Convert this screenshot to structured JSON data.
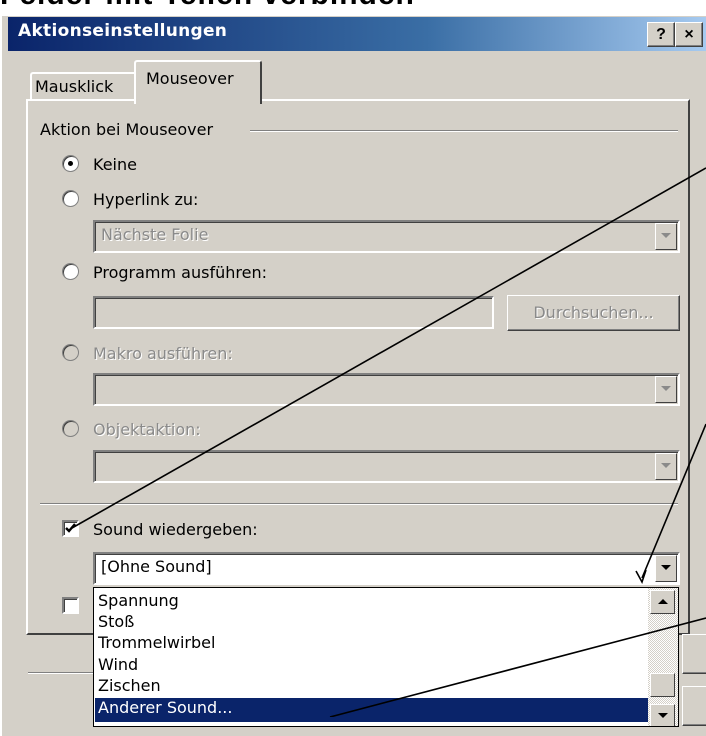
{
  "page": {
    "heading": "Felder mit Teilen verbinden"
  },
  "dialog": {
    "title": "Aktionseinstellungen",
    "help_button": "?",
    "close_button": "×",
    "tabs": [
      {
        "label": "Mausklick",
        "active": false
      },
      {
        "label": "Mouseover",
        "active": true
      }
    ],
    "group_label": "Aktion bei Mouseover",
    "options": {
      "keine": {
        "label": "Keine",
        "selected": true
      },
      "hyperlink": {
        "label": "Hyperlink zu:",
        "value": "Nächste Folie"
      },
      "programm": {
        "label": "Programm ausführen:",
        "value": "",
        "browse_button": "Durchsuchen..."
      },
      "makro": {
        "label": "Makro ausführen:",
        "enabled": false
      },
      "objekt": {
        "label": "Objektaktion:",
        "enabled": false
      }
    },
    "sound": {
      "label": "Sound wiedergeben:",
      "checked": true,
      "selected": "[Ohne Sound]",
      "list": [
        "Spannung",
        "Stoß",
        "Trommelwirbel",
        "Wind",
        "Zischen",
        "Anderer Sound..."
      ],
      "highlighted": "Anderer Sound..."
    },
    "second_checkbox_checked": false
  },
  "colors": {
    "titlebar_start": "#0a246a",
    "titlebar_end": "#a6caf0",
    "face": "#d4d0c8",
    "selection": "#0a246a"
  }
}
